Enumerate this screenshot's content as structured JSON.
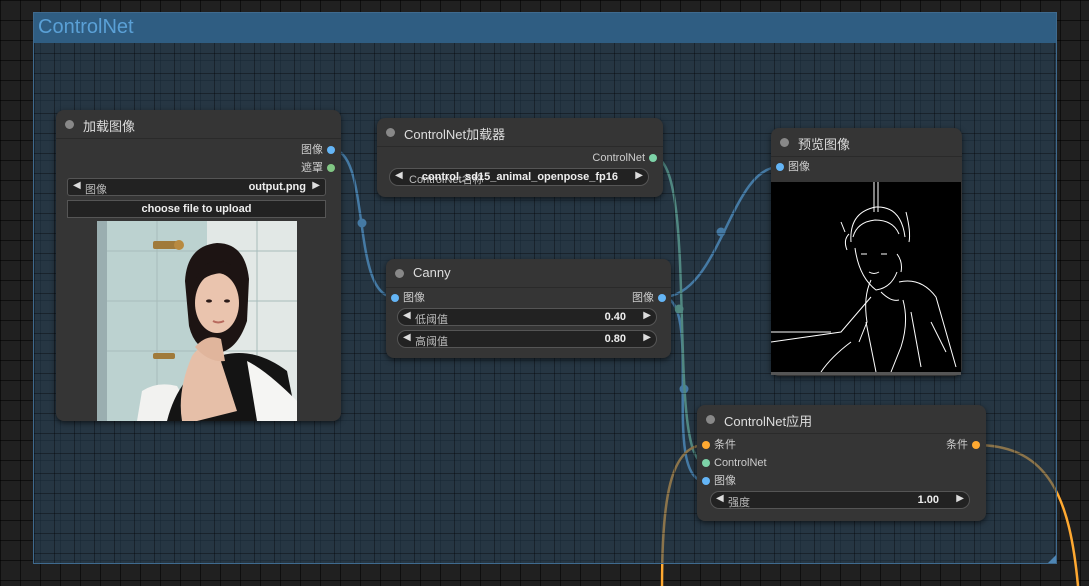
{
  "group": {
    "title": "ControlNet"
  },
  "nodes": {
    "load_image": {
      "title": "加载图像",
      "outputs": [
        "图像",
        "遮罩"
      ],
      "widget": {
        "label": "图像",
        "value": "output.png"
      },
      "upload_label": "choose file to upload"
    },
    "cnet_loader": {
      "title": "ControlNet加载器",
      "output": "ControlNet",
      "widget_label": "ControlNet名称",
      "widget_value": "control_sd15_animal_openpose_fp16"
    },
    "canny": {
      "title": "Canny",
      "input": "图像",
      "output": "图像",
      "low": {
        "label": "低阈值",
        "value": "0.40"
      },
      "high": {
        "label": "高阈值",
        "value": "0.80"
      }
    },
    "preview": {
      "title": "预览图像",
      "input": "图像"
    },
    "apply": {
      "title": "ControlNet应用",
      "inputs": [
        "条件",
        "ControlNet",
        "图像"
      ],
      "output": "条件",
      "strength": {
        "label": "强度",
        "value": "1.00"
      }
    }
  },
  "colors": {
    "image": "#64b5f6",
    "mask": "#81c784",
    "controlnet": "#7dd3a8",
    "conditioning": "#ffa931",
    "group": "#2f5d82"
  }
}
